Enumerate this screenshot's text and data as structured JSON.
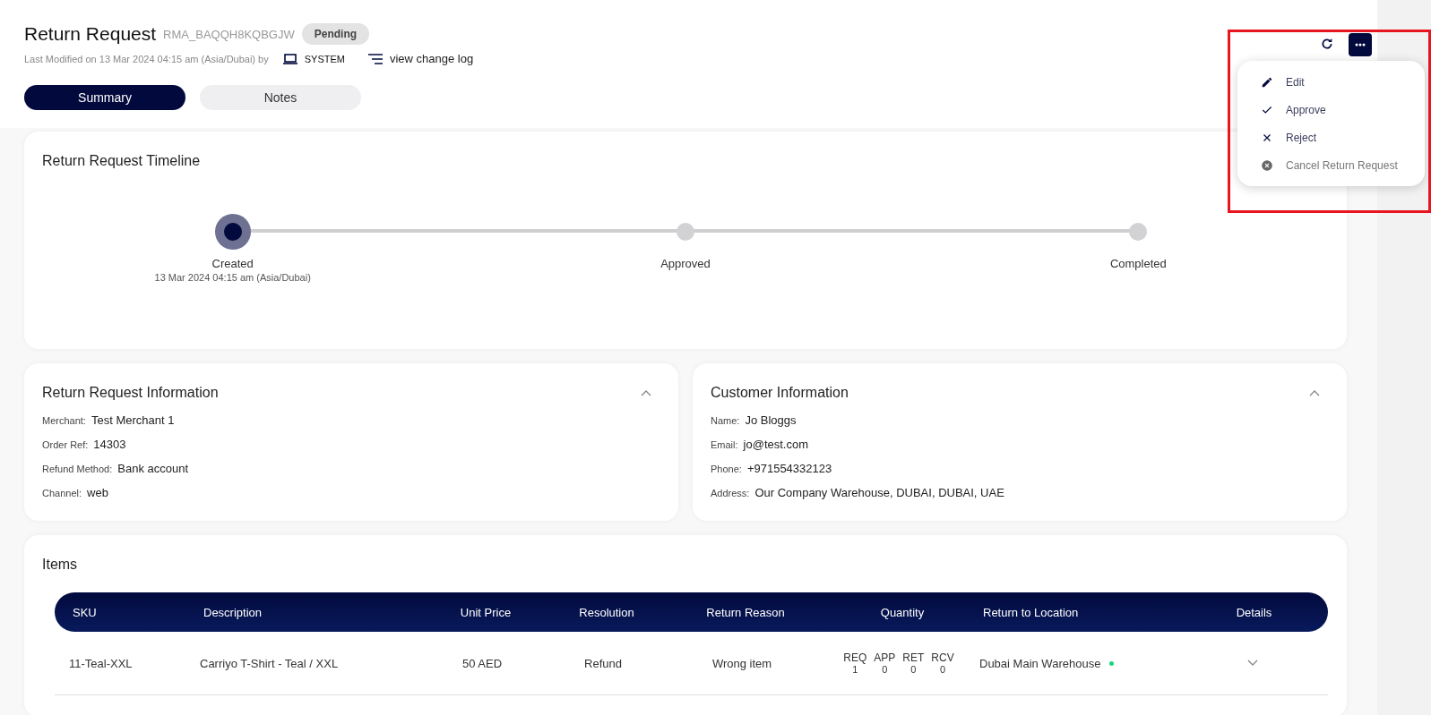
{
  "header": {
    "title": "Return Request",
    "reference": "RMA_BAQQH8KQBGJW",
    "status": "Pending",
    "modified": "Last Modified on 13 Mar 2024 04:15 am (Asia/Dubai) by",
    "modified_by": "SYSTEM",
    "change_log": "view change log"
  },
  "tabs": [
    {
      "label": "Summary",
      "selected": true
    },
    {
      "label": "Notes",
      "selected": false
    }
  ],
  "actions_menu": {
    "expanded": true,
    "items": [
      {
        "kind": "edit",
        "label": "Edit"
      },
      {
        "kind": "approve",
        "label": "Approve"
      },
      {
        "kind": "reject",
        "label": "Reject"
      },
      {
        "kind": "cancel",
        "label": "Cancel Return Request"
      }
    ]
  },
  "timeline": {
    "title": "Return Request Timeline",
    "steps": [
      {
        "label": "Created",
        "date": "13 Mar 2024 04:15 am (Asia/Dubai)",
        "completed": true
      },
      {
        "label": "Approved",
        "completed": false
      },
      {
        "label": "Completed",
        "completed": false
      }
    ]
  },
  "return_info": {
    "title": "Return Request Information",
    "expanded": true,
    "fields": [
      {
        "label": "Merchant:",
        "value": "Test Merchant 1"
      },
      {
        "label": "Order Ref:",
        "value": "14303"
      },
      {
        "label": "Refund Method:",
        "value": "Bank account"
      },
      {
        "label": "Channel:",
        "value": "web"
      }
    ]
  },
  "customer_info": {
    "title": "Customer Information",
    "expanded": true,
    "fields": [
      {
        "label": "Name:",
        "value": "Jo Bloggs"
      },
      {
        "label": "Email:",
        "value": "jo@test.com"
      },
      {
        "label": "Phone:",
        "value": "+971554332123"
      },
      {
        "label": "Address:",
        "value": "Our Company Warehouse, DUBAI, DUBAI, UAE"
      }
    ]
  },
  "items": {
    "title": "Items",
    "columns": [
      "SKU",
      "Description",
      "Unit Price",
      "Resolution",
      "Return Reason",
      "Quantity",
      "Return to Location",
      "Details"
    ],
    "rows": [
      {
        "sku": "11-Teal-XXL",
        "description": "Carriyo T-Shirt - Teal / XXL",
        "unit_price": "50 AED",
        "resolution": "Refund",
        "reason": "Wrong item",
        "quantities": [
          {
            "label": "REQ",
            "value": "1"
          },
          {
            "label": "APP",
            "value": "0"
          },
          {
            "label": "RET",
            "value": "0"
          },
          {
            "label": "RCV",
            "value": "0"
          }
        ],
        "location": "Dubai Main Warehouse",
        "expanded": false
      }
    ]
  }
}
